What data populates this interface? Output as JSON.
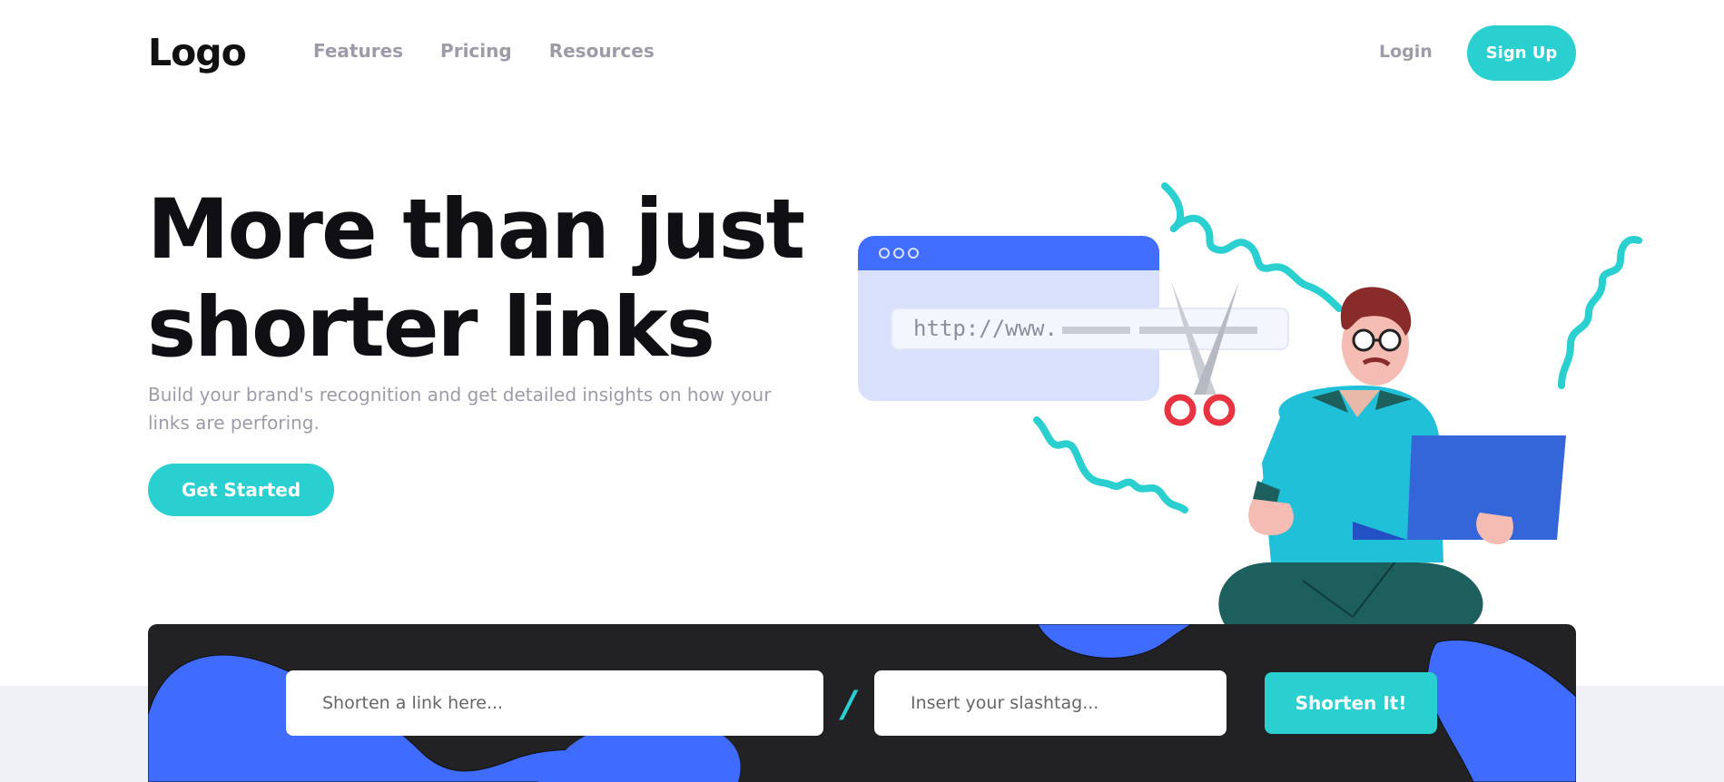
{
  "header": {
    "logo": "Logo",
    "nav": [
      "Features",
      "Pricing",
      "Resources"
    ],
    "login": "Login",
    "signup": "Sign Up"
  },
  "hero": {
    "title": "More than just shorter links",
    "subtitle": "Build your brand's recognition and get detailed insights on how your links are perforing.",
    "cta": "Get Started",
    "illustration": {
      "url_text": "http://www."
    }
  },
  "shorten": {
    "link_placeholder": "Shorten a link here...",
    "separator": "/",
    "slashtag_placeholder": "Insert your slashtag...",
    "button": "Shorten It!"
  },
  "colors": {
    "accent": "#2acfcf",
    "dark": "#222224",
    "blob": "#3f6bff",
    "text_muted": "#9e9aa8"
  }
}
